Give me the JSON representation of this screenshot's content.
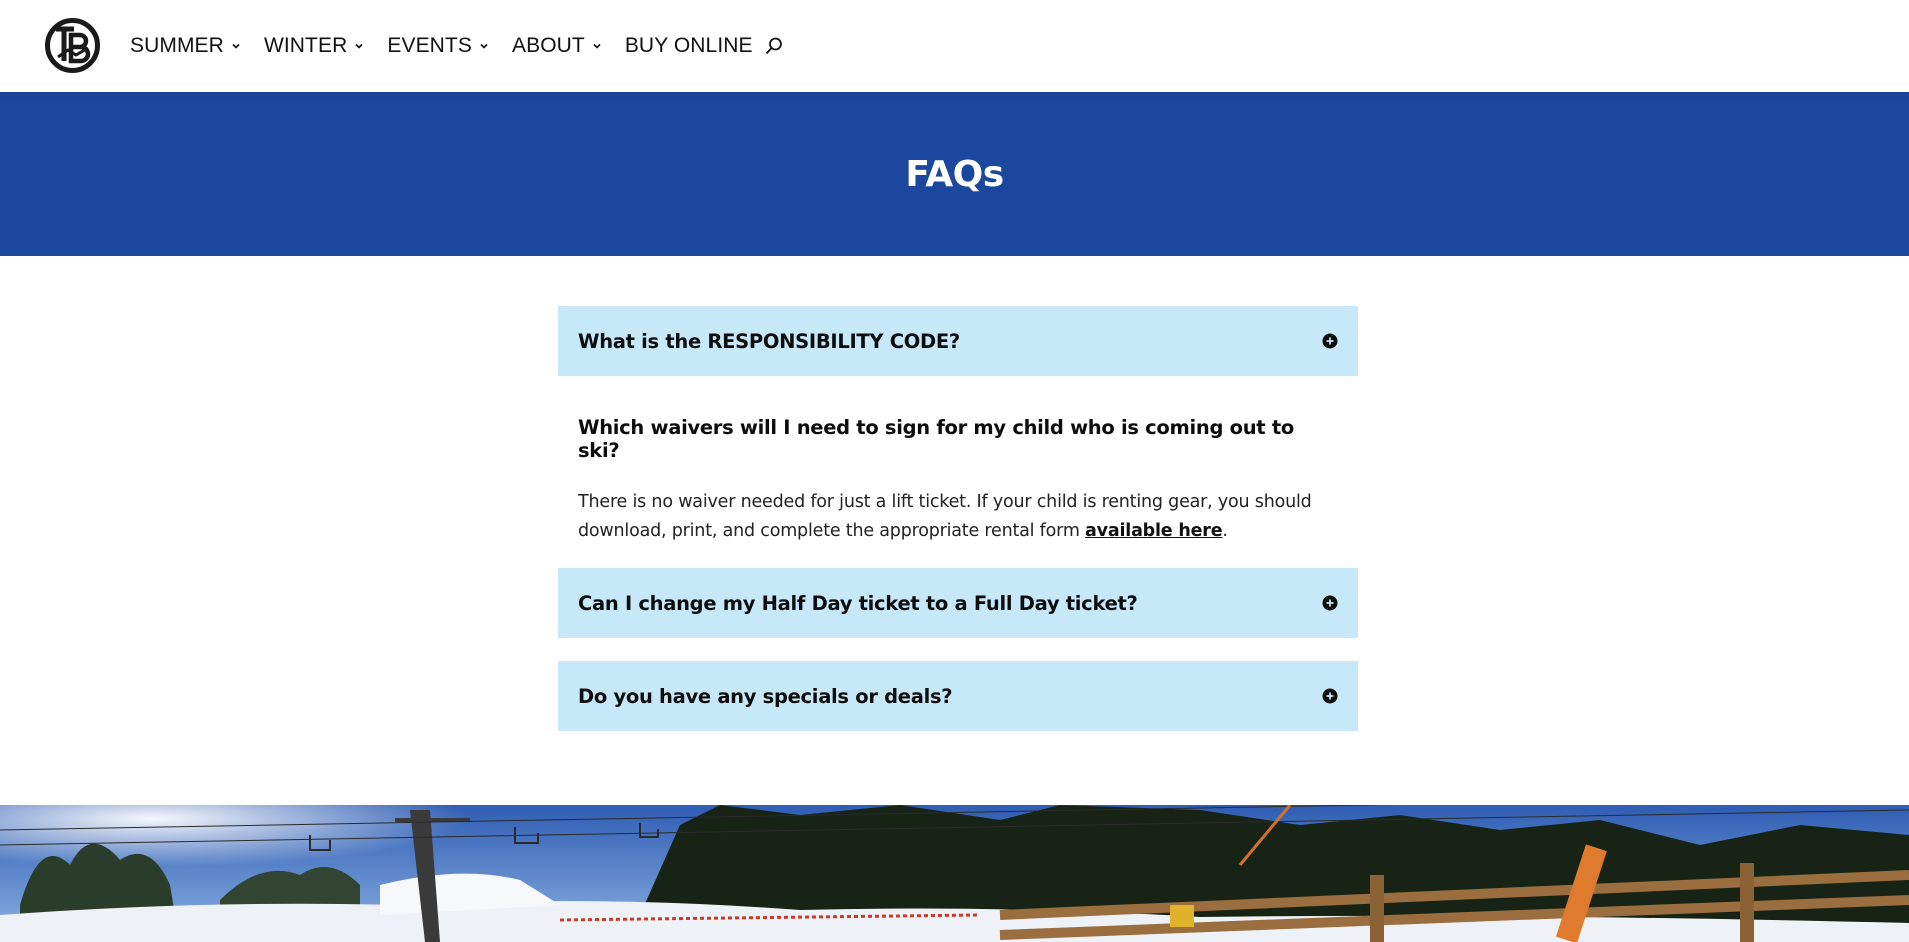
{
  "nav": {
    "items": [
      {
        "label": "SUMMER",
        "has_dropdown": true
      },
      {
        "label": "WINTER",
        "has_dropdown": true
      },
      {
        "label": "EVENTS",
        "has_dropdown": true
      },
      {
        "label": "ABOUT",
        "has_dropdown": true
      },
      {
        "label": "BUY ONLINE",
        "has_dropdown": false
      }
    ],
    "search_icon": "search-icon"
  },
  "hero": {
    "title": "FAQs",
    "background": "#1b479f"
  },
  "faq": {
    "accent_bg": "#c7e8f8",
    "items": [
      {
        "question": "What is the RESPONSIBILITY CODE?",
        "expanded": false,
        "icon": "plus-circle-icon"
      },
      {
        "question": "Which waivers will I need to sign for my child who is coming out to ski?",
        "expanded": true,
        "answer_text": "There is no waiver needed for just a lift ticket. If your child is renting gear, you should download, print, and complete the appropriate rental form ",
        "answer_link": "available here",
        "answer_end": "."
      },
      {
        "question": "Can I change my Half Day ticket to a Full Day ticket?",
        "expanded": false,
        "icon": "plus-circle-icon"
      },
      {
        "question": "Do you have any specials or deals?",
        "expanded": false,
        "icon": "plus-circle-icon"
      }
    ]
  }
}
